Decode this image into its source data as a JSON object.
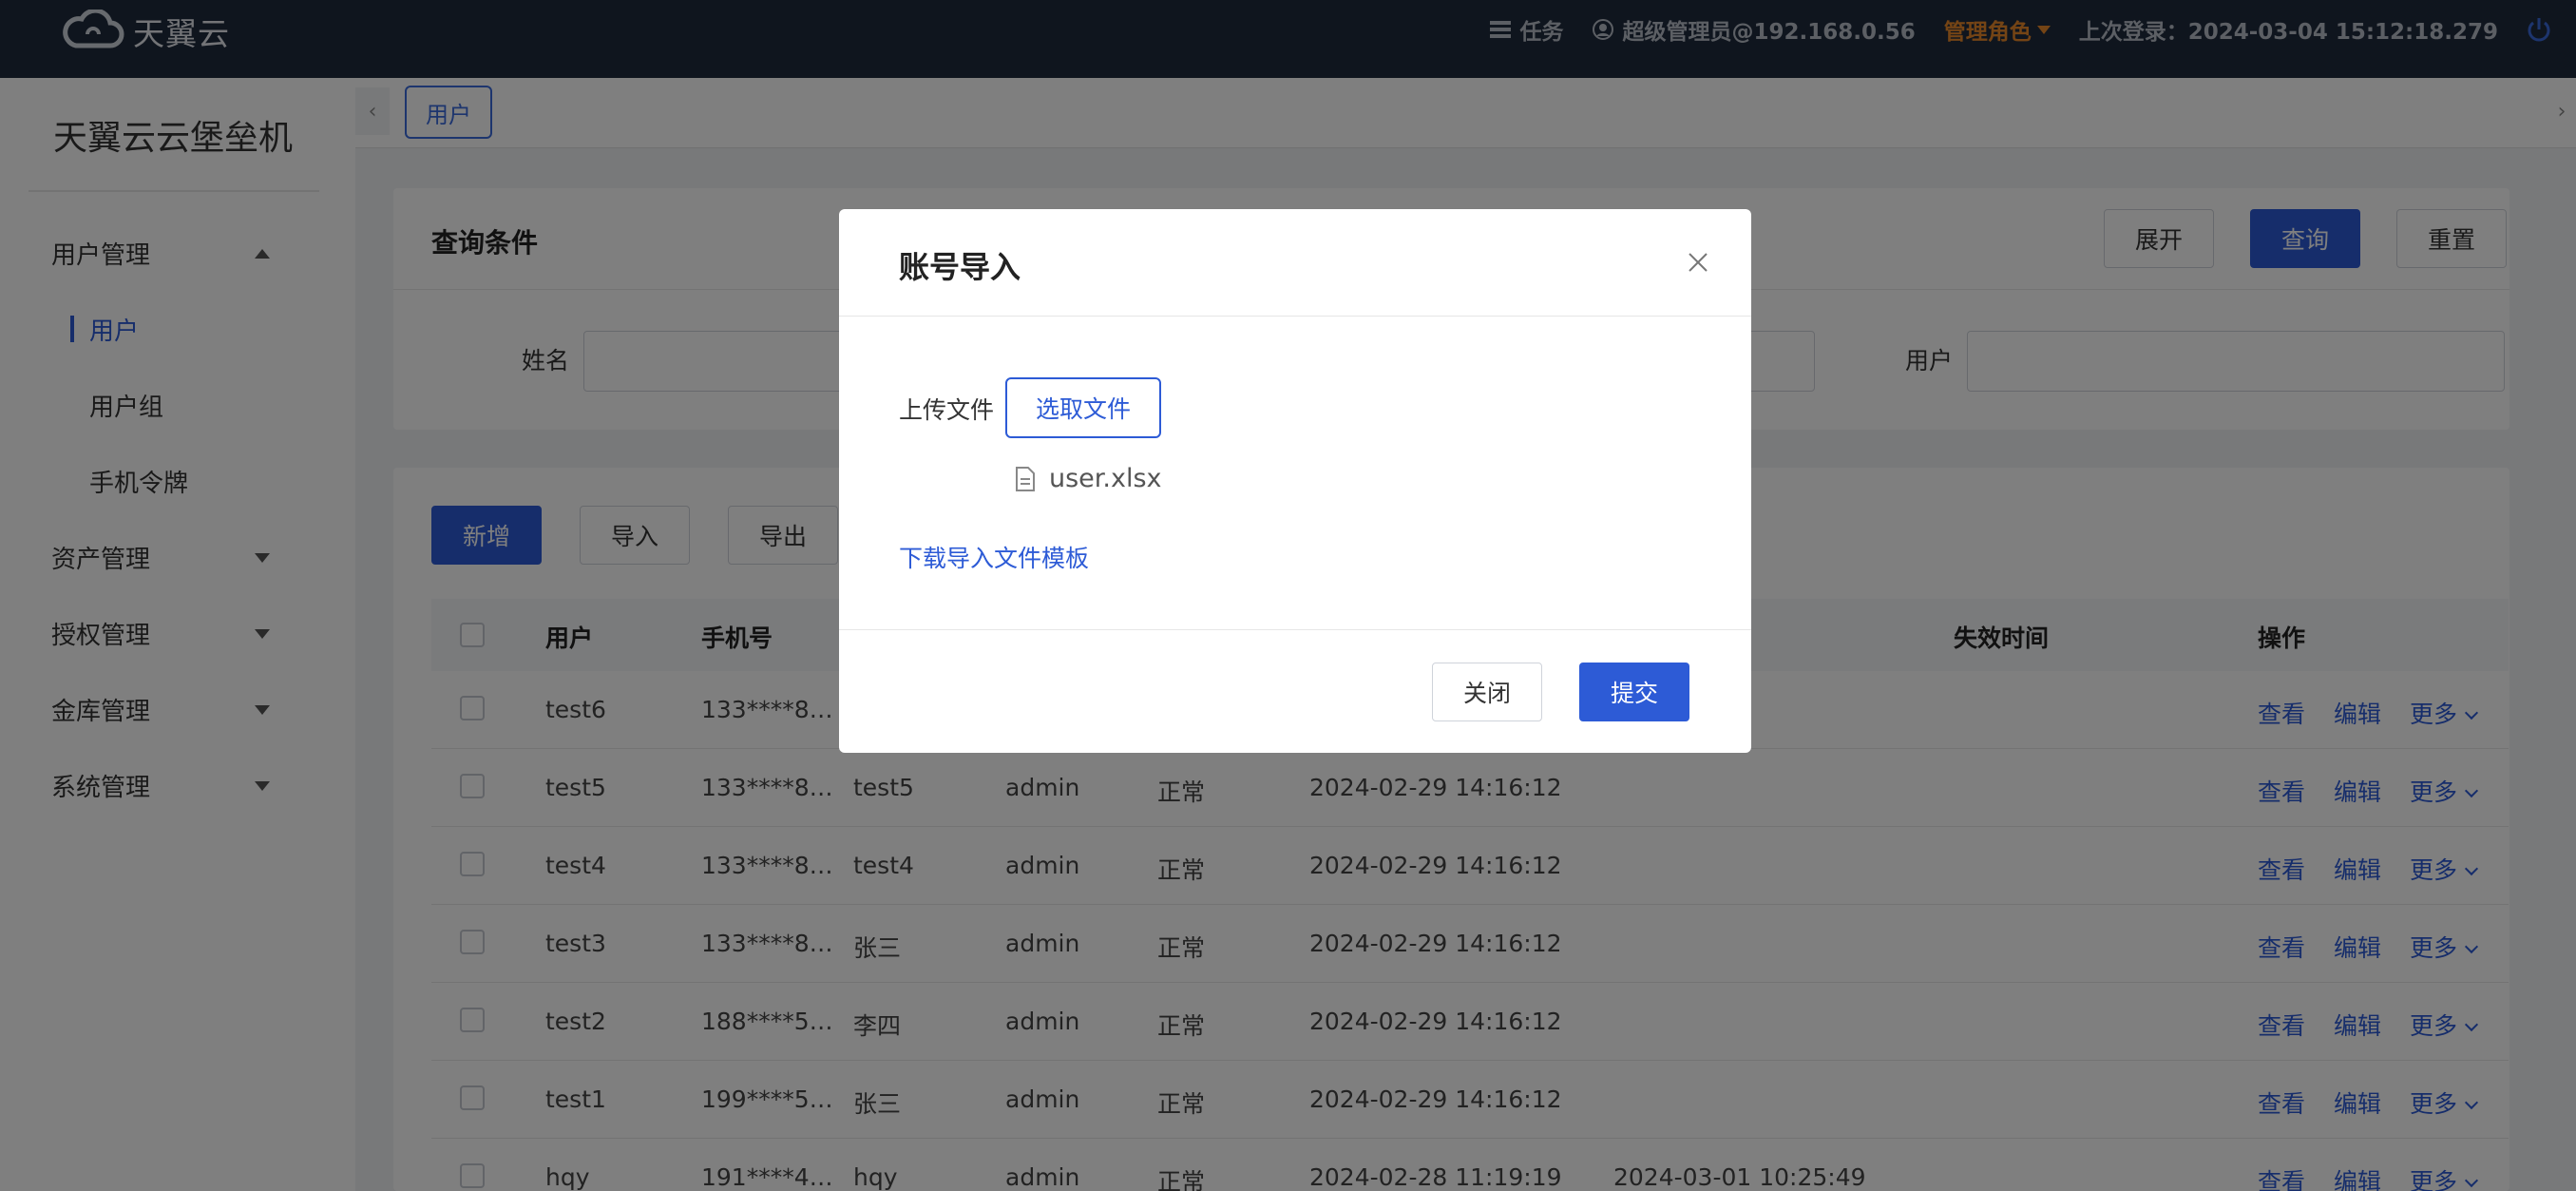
{
  "header": {
    "brand": "天翼云",
    "tasks_label": "任务",
    "user_label": "超级管理员@192.168.0.56",
    "role_label": "管理角色",
    "last_login": "上次登录：2024-03-04 15:12:18.279"
  },
  "sidebar": {
    "title": "天翼云云堡垒机",
    "groups": [
      {
        "label": "用户管理",
        "subitems": [
          "用户",
          "用户组",
          "手机令牌"
        ]
      },
      {
        "label": "资产管理"
      },
      {
        "label": "授权管理"
      },
      {
        "label": "金库管理"
      },
      {
        "label": "系统管理"
      }
    ]
  },
  "tabs": {
    "active": "用户"
  },
  "query": {
    "title": "查询条件",
    "expand": "展开",
    "search": "查询",
    "reset": "重置",
    "name_label": "姓名",
    "user_label": "用户"
  },
  "toolbar": {
    "add": "新增",
    "import": "导入",
    "export": "导出"
  },
  "table": {
    "headers": {
      "user": "用户",
      "phone": "手机号",
      "expire": "失效时间",
      "ops": "操作"
    },
    "ops": {
      "view": "查看",
      "edit": "编辑",
      "more": "更多"
    },
    "rows": [
      {
        "user": "test6",
        "phone": "133****8…",
        "name": "",
        "creator": "",
        "status": "",
        "created": "",
        "expire": ""
      },
      {
        "user": "test5",
        "phone": "133****8…",
        "name": "test5",
        "creator": "admin",
        "status": "正常",
        "created": "2024-02-29 14:16:12",
        "expire": ""
      },
      {
        "user": "test4",
        "phone": "133****8…",
        "name": "test4",
        "creator": "admin",
        "status": "正常",
        "created": "2024-02-29 14:16:12",
        "expire": ""
      },
      {
        "user": "test3",
        "phone": "133****8…",
        "name": "张三",
        "creator": "admin",
        "status": "正常",
        "created": "2024-02-29 14:16:12",
        "expire": ""
      },
      {
        "user": "test2",
        "phone": "188****5…",
        "name": "李四",
        "creator": "admin",
        "status": "正常",
        "created": "2024-02-29 14:16:12",
        "expire": ""
      },
      {
        "user": "test1",
        "phone": "199****5…",
        "name": "张三",
        "creator": "admin",
        "status": "正常",
        "created": "2024-02-29 14:16:12",
        "expire": ""
      },
      {
        "user": "hqy",
        "phone": "191****4…",
        "name": "hqy",
        "creator": "admin",
        "status": "正常",
        "created": "2024-02-28 11:19:19",
        "expire": "2024-03-01 10:25:49"
      }
    ]
  },
  "modal": {
    "title": "账号导入",
    "upload_label": "上传文件",
    "choose_button": "选取文件",
    "file_name": "user.xlsx",
    "download_link": "下载导入文件模板",
    "close_button": "关闭",
    "submit_button": "提交"
  },
  "colors": {
    "primary": "#2d5bd6",
    "header_bg": "#1f2a3d",
    "role": "#e8892b"
  }
}
